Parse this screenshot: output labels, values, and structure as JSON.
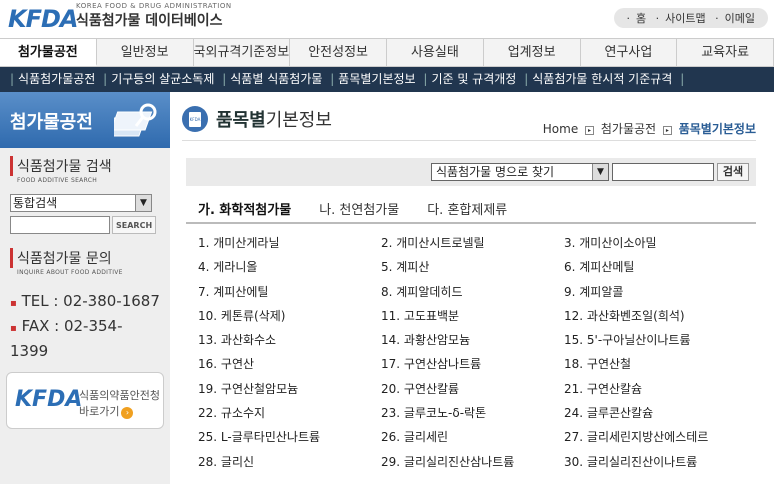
{
  "header": {
    "logo_mark": "KFDA",
    "logo_sub": "KOREA FOOD & DRUG ADMINISTRATION",
    "logo_main": "식품첨가물 데이터베이스",
    "util_links": [
      "홈",
      "사이트맵",
      "이메일"
    ]
  },
  "mainnav": [
    "첨가물공전",
    "일반정보",
    "국외규격기준정보",
    "안전성정보",
    "사용실태",
    "업계정보",
    "연구사업",
    "교육자료"
  ],
  "subnav": [
    "식품첨가물공전",
    "기구등의 살균소독제",
    "식품별 식품첨가물",
    "품목별기본정보",
    "기준 및 규격개정",
    "식품첨가물 한시적 기준규격"
  ],
  "sidebar": {
    "banner_title": "첨가물공전",
    "search_title": "식품첨가물 검색",
    "search_sub": "FOOD ADDITIVE SEARCH",
    "search_select": "통합검색",
    "search_button": "SEARCH",
    "inquiry_title": "식품첨가물 문의",
    "inquiry_sub": "INQUIRE ABOUT FOOD ADDITIVE",
    "tel": "TEL : 02-380-1687",
    "fax": "FAX : 02-354-1399",
    "banner_mark": "KFDA",
    "banner_line1": "식품의약품안전청",
    "banner_line2": "바로가기"
  },
  "content": {
    "title_strong": "품목별",
    "title_rest": "기본정보",
    "breadcrumb": [
      "Home",
      "첨가물공전",
      "품목별기본정보"
    ],
    "search_select": "식품첨가물 명으로 찾기",
    "search_button": "검색",
    "tabs": [
      "가. 화학적첨가물",
      "나. 천연첨가물",
      "다. 혼합제제류"
    ],
    "items": [
      [
        "1. 개미산게라닐",
        "2. 개미산시트로넬릴",
        "3. 개미산이소아밀"
      ],
      [
        "4. 게라니올",
        "5. 계피산",
        "6. 계피산메틸"
      ],
      [
        "7. 계피산에틸",
        "8. 계피알데히드",
        "9. 계피알콜"
      ],
      [
        "10. 케톤류(삭제)",
        "11. 고도표백분",
        "12. 과산화벤조일(희석)"
      ],
      [
        "13. 과산화수소",
        "14. 과황산암모늄",
        "15. 5'-구아닐산이나트륨"
      ],
      [
        "16. 구연산",
        "17. 구연산삼나트륨",
        "18. 구연산철"
      ],
      [
        "19. 구연산철암모늄",
        "20. 구연산칼륨",
        "21. 구연산칼슘"
      ],
      [
        "22. 규소수지",
        "23. 글루코노-δ-락톤",
        "24. 글루콘산칼슘"
      ],
      [
        "25. L-글루타민산나트륨",
        "26. 글리세린",
        "27. 글리세린지방산에스테르"
      ],
      [
        "28. 글리신",
        "29. 글리실리진산삼나트륨",
        "30. 글리실리진산이나트륨"
      ]
    ]
  }
}
